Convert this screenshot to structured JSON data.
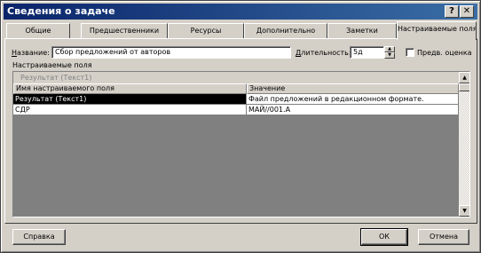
{
  "window": {
    "title": "Сведения о задаче",
    "help_glyph": "?",
    "close_glyph": "✕"
  },
  "tabs": [
    {
      "label": "Общие",
      "active": false
    },
    {
      "label": "Предшественники",
      "active": false
    },
    {
      "label": "Ресурсы",
      "active": false
    },
    {
      "label": "Дополнительно",
      "active": false
    },
    {
      "label": "Заметки",
      "active": false
    },
    {
      "label": "Настраиваемые поля",
      "active": true
    }
  ],
  "form": {
    "name_label_accel": "Н",
    "name_label_rest": "азвание:",
    "name_value": "Сбор предложений от авторов",
    "duration_label_pre": "",
    "duration_label_accel": "Д",
    "duration_label_rest": "лительность:",
    "duration_value": "5д",
    "spin_up": "▲",
    "spin_down": "▼",
    "estimate_label": "Предв. оценка",
    "estimate_checked": false
  },
  "custom_fields": {
    "section_label": "Настраиваемые поля",
    "edit_row_value": "Результат (Текст1)",
    "columns": [
      "Имя настраиваемого поля",
      "Значение"
    ],
    "rows": [
      {
        "name": "Результат (Текст1)",
        "value": "Файл предложений в редакционном формате.",
        "selected": true
      },
      {
        "name": "СДР",
        "value": "МАЙ//001.А",
        "selected": false
      }
    ],
    "scroll_up": "▲",
    "scroll_down": "▼"
  },
  "buttons": {
    "help": "Справка",
    "ok": "ОК",
    "cancel": "Отмена"
  }
}
